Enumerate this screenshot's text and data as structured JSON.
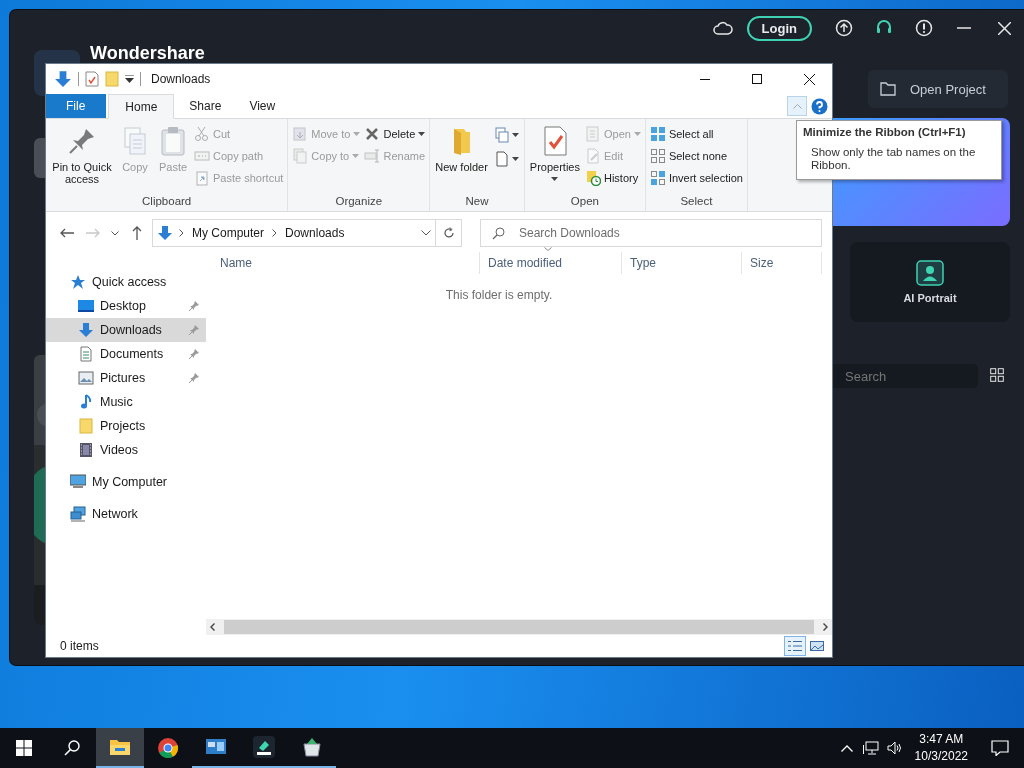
{
  "app_window": {
    "brand": "Wondershare",
    "login": "Login",
    "open_project": "Open Project",
    "ai_portrait": "AI Portrait",
    "search": {
      "placeholder": "Search"
    }
  },
  "explorer": {
    "title": "Downloads",
    "tabs": [
      {
        "label": "File",
        "kind": "file",
        "selected": false
      },
      {
        "label": "Home",
        "kind": "tab",
        "selected": true
      },
      {
        "label": "Share",
        "kind": "tab",
        "selected": false
      },
      {
        "label": "View",
        "kind": "tab",
        "selected": false
      }
    ],
    "ribbon_groups": [
      {
        "label": "Clipboard",
        "columns": [
          {
            "kind": "large",
            "items": [
              {
                "label": "Pin to Quick access",
                "disabled": false,
                "dropdown": false
              }
            ]
          },
          {
            "kind": "large",
            "items": [
              {
                "label": "Copy",
                "disabled": true,
                "dropdown": false
              }
            ]
          },
          {
            "kind": "large",
            "items": [
              {
                "label": "Paste",
                "disabled": true,
                "dropdown": false
              }
            ]
          },
          {
            "kind": "small",
            "items": [
              {
                "label": "Cut",
                "disabled": true,
                "dropdown": false
              },
              {
                "label": "Copy path",
                "disabled": true,
                "dropdown": false
              },
              {
                "label": "Paste shortcut",
                "disabled": true,
                "dropdown": false
              }
            ]
          }
        ]
      },
      {
        "label": "Organize",
        "columns": [
          {
            "kind": "small",
            "items": [
              {
                "label": "Move to",
                "disabled": true,
                "dropdown": true
              },
              {
                "label": "Copy to",
                "disabled": true,
                "dropdown": true
              }
            ]
          },
          {
            "kind": "small",
            "items": [
              {
                "label": "Delete",
                "disabled": false,
                "dropdown": true
              },
              {
                "label": "Rename",
                "disabled": true,
                "dropdown": false
              }
            ]
          }
        ]
      },
      {
        "label": "New",
        "columns": [
          {
            "kind": "large",
            "items": [
              {
                "label": "New folder",
                "disabled": false,
                "dropdown": false
              }
            ]
          },
          {
            "kind": "icon",
            "items": [
              {
                "disabled": false,
                "dropdown": true
              },
              {
                "disabled": false,
                "dropdown": true
              }
            ]
          }
        ]
      },
      {
        "label": "Open",
        "columns": [
          {
            "kind": "large",
            "items": [
              {
                "label": "Properties",
                "disabled": false,
                "dropdown": true
              }
            ]
          },
          {
            "kind": "small",
            "items": [
              {
                "label": "Open",
                "disabled": true,
                "dropdown": true
              },
              {
                "label": "Edit",
                "disabled": true,
                "dropdown": false
              },
              {
                "label": "History",
                "disabled": false,
                "dropdown": false
              }
            ]
          }
        ]
      },
      {
        "label": "Select",
        "columns": [
          {
            "kind": "small",
            "items": [
              {
                "label": "Select all",
                "disabled": false,
                "dropdown": false
              },
              {
                "label": "Select none",
                "disabled": false,
                "dropdown": false
              },
              {
                "label": "Invert selection",
                "disabled": false,
                "dropdown": false
              }
            ]
          }
        ]
      }
    ],
    "address": {
      "path": [
        "My Computer",
        "Downloads"
      ]
    },
    "search": {
      "placeholder": "Search Downloads"
    },
    "nav": [
      {
        "label": "Quick access",
        "selected": false,
        "pinned": false,
        "children": [
          {
            "label": "Desktop",
            "selected": false,
            "pinned": true
          },
          {
            "label": "Downloads",
            "selected": true,
            "pinned": true
          },
          {
            "label": "Documents",
            "selected": false,
            "pinned": true
          },
          {
            "label": "Pictures",
            "selected": false,
            "pinned": true
          },
          {
            "label": "Music",
            "selected": false,
            "pinned": false
          },
          {
            "label": "Projects",
            "selected": false,
            "pinned": false
          },
          {
            "label": "Videos",
            "selected": false,
            "pinned": false
          }
        ]
      },
      {
        "label": "My Computer",
        "selected": false,
        "pinned": false
      },
      {
        "label": "Network",
        "selected": false,
        "pinned": false
      }
    ],
    "columns": [
      {
        "label": "Name",
        "sorted": false
      },
      {
        "label": "Date modified",
        "sorted": true
      },
      {
        "label": "Type",
        "sorted": false
      },
      {
        "label": "Size",
        "sorted": false
      }
    ],
    "empty_message": "This folder is empty.",
    "status": "0 items",
    "views": [
      {
        "kind": "details",
        "selected": true
      },
      {
        "kind": "thumbnails",
        "selected": false
      }
    ]
  },
  "tooltip": {
    "title": "Minimize the Ribbon (Ctrl+F1)",
    "text": "Show only the tab names on the Ribbon."
  },
  "taskbar": {
    "apps": [
      {
        "kind": "explorer",
        "selected": true,
        "running": true
      },
      {
        "kind": "chrome",
        "selected": false,
        "running": false
      },
      {
        "kind": "control",
        "selected": false,
        "running": true
      },
      {
        "kind": "editor",
        "selected": false,
        "running": true
      },
      {
        "kind": "store",
        "selected": false,
        "running": true
      }
    ],
    "time": "3:47 AM",
    "date": "10/3/2022"
  }
}
